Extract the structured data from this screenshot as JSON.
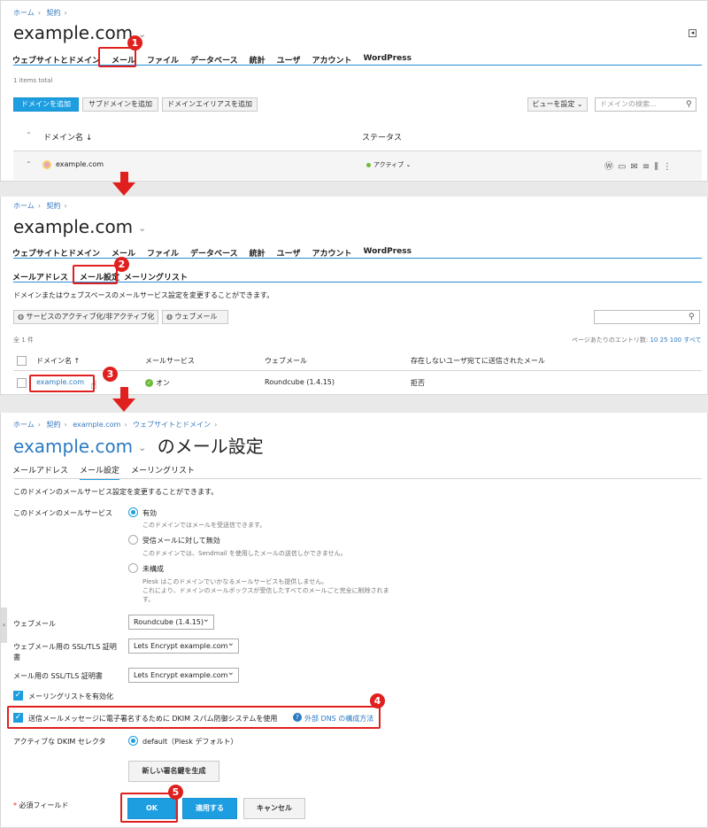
{
  "p1": {
    "breadcrumb": [
      "ホーム",
      "契約"
    ],
    "title": "example.com",
    "tabs": [
      "ウェブサイトとドメイン",
      "メール",
      "ファイル",
      "データベース",
      "統計",
      "ユーザ",
      "アカウント",
      "WordPress"
    ],
    "items_total": "1 items total",
    "buttons": {
      "add_domain": "ドメインを追加",
      "add_subdomain": "サブドメインを追加",
      "add_alias": "ドメインエイリアスを追加",
      "view": "ビューを設定 ⌄"
    },
    "search_placeholder": "ドメインの検索...",
    "col_domain": "ドメイン名 ↓",
    "col_status": "ステータス",
    "row_domain": "example.com",
    "row_status": "アクティブ ⌄"
  },
  "p2": {
    "breadcrumb": [
      "ホーム",
      "契約"
    ],
    "title": "example.com",
    "tabs": [
      "ウェブサイトとドメイン",
      "メール",
      "ファイル",
      "データベース",
      "統計",
      "ユーザ",
      "アカウント",
      "WordPress"
    ],
    "subtabs": [
      "メールアドレス",
      "メール設定",
      "メーリングリスト"
    ],
    "desc": "ドメインまたはウェブスペースのメールサービス設定を変更することができます。",
    "btn_toggle": "サービスのアクティブ化/非アクティブ化",
    "btn_webmail": "ウェブメール",
    "count": "全 1 件",
    "per_page_label": "ページあたりのエントリ数:",
    "per_page_options": [
      "10",
      "25",
      "100",
      "すべて"
    ],
    "columns": [
      "ドメイン名 ↑",
      "メールサービス",
      "ウェブメール",
      "存在しないユーザ宛てに送信されたメール"
    ],
    "row": {
      "domain": "example.com",
      "service": "オン",
      "webmail": "Roundcube (1.4.15)",
      "undeliverable": "拒否"
    }
  },
  "p3": {
    "breadcrumb": [
      "ホーム",
      "契約",
      "example.com",
      "ウェブサイトとドメイン"
    ],
    "title_link": "example.com",
    "title_suffix": "のメール設定",
    "subtabs": [
      "メールアドレス",
      "メール設定",
      "メーリングリスト"
    ],
    "desc": "このドメインのメールサービス設定を変更することができます。",
    "service_label": "このドメインのメールサービス",
    "opt_enabled": "有効",
    "opt_enabled_hint": "このドメインではメールを受送信できます。",
    "opt_disabled": "受信メールに対して無効",
    "opt_disabled_hint": "このドメインでは、Sendmail を使用したメールの送信しかできません。",
    "opt_unconfigured": "未構成",
    "opt_unconfigured_hint1": "Plesk はこのドメインでいかなるメールサービスも提供しません。",
    "opt_unconfigured_hint2": "これにより、ドメインのメールボックスが受信したすべてのメールごと完全に削除されま",
    "opt_unconfigured_hint3": "す。",
    "webmail_label": "ウェブメール",
    "webmail_value": "Roundcube (1.4.15)",
    "ssl_webmail_label1": "ウェブメール用の SSL/TLS 証明",
    "ssl_webmail_label2": "書",
    "ssl_webmail_value": "Lets Encrypt example.com",
    "ssl_mail_label": "メール用の SSL/TLS 証明書",
    "ssl_mail_value": "Lets Encrypt example.com",
    "mailing_list": "メーリングリストを有効化",
    "dkim": "送信メールメッセージに電子署名するために DKIM スパム防御システムを使用",
    "dns_link": "外部 DNS の構成方法",
    "selector_label": "アクティブな DKIM セレクタ",
    "selector_value": "default（Plesk デフォルト）",
    "new_key_btn": "新しい署名鍵を生成",
    "required": "必須フィールド",
    "ok": "OK",
    "apply": "適用する",
    "cancel": "キャンセル"
  },
  "badges": [
    "1",
    "2",
    "3",
    "4",
    "5"
  ],
  "colors": {
    "accent": "#1d9ee0",
    "annotation": "#e0201e",
    "link": "#2a7ac2"
  }
}
